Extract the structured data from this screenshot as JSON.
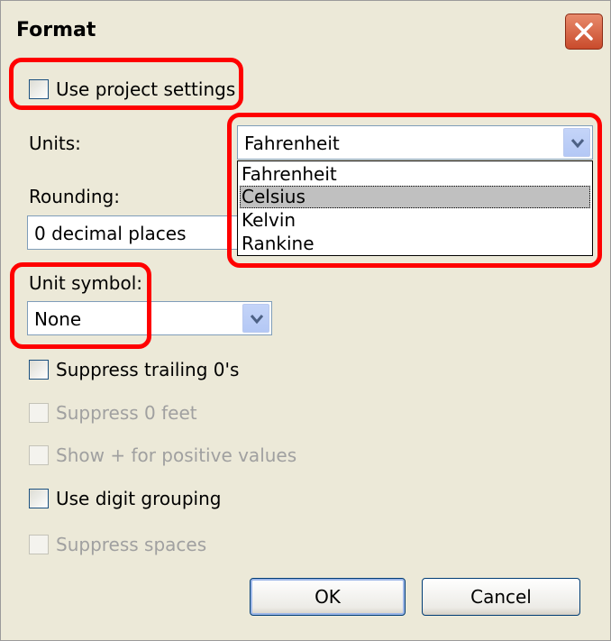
{
  "dialog": {
    "title": "Format"
  },
  "use_project_settings": {
    "label": "Use project settings",
    "checked": false
  },
  "units": {
    "label": "Units:",
    "value": "Fahrenheit",
    "options": [
      "Fahrenheit",
      "Celsius",
      "Kelvin",
      "Rankine"
    ],
    "highlighted": "Celsius"
  },
  "rounding": {
    "label": "Rounding:",
    "value": "0 decimal places"
  },
  "unit_symbol": {
    "label": "Unit symbol:",
    "value": "None"
  },
  "options": {
    "suppress_trailing": {
      "label": "Suppress trailing 0's",
      "enabled": true,
      "checked": false
    },
    "suppress_feet": {
      "label": "Suppress 0 feet",
      "enabled": false,
      "checked": false
    },
    "show_plus": {
      "label": "Show + for positive values",
      "enabled": false,
      "checked": false
    },
    "digit_grouping": {
      "label": "Use digit grouping",
      "enabled": true,
      "checked": false
    },
    "suppress_spaces": {
      "label": "Suppress spaces",
      "enabled": false,
      "checked": false
    }
  },
  "buttons": {
    "ok": "OK",
    "cancel": "Cancel"
  },
  "colors": {
    "highlight_annotation": "#ff0000",
    "dialog_bg": "#ece9d8",
    "dropdown_selection": "#c0c0c0"
  }
}
